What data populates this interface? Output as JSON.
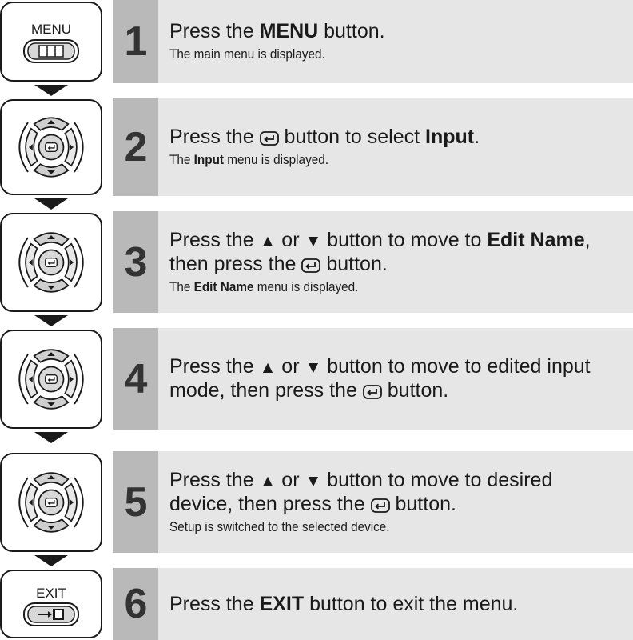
{
  "steps": [
    {
      "number": "1",
      "remote": "menu-button",
      "remote_label": "MENU",
      "main": {
        "a": "Press the ",
        "b": "MENU",
        "c": " button."
      },
      "sub": "The main menu is displayed."
    },
    {
      "number": "2",
      "remote": "directional-pad",
      "main": {
        "a": "Press the ",
        "b": " button to select ",
        "c": "Input",
        "d": "."
      },
      "sub": {
        "a": "Input",
        "b": " menu is displayed.",
        "prefix": "The "
      }
    },
    {
      "number": "3",
      "remote": "directional-pad",
      "main": {
        "a": "Press the ",
        "up": "▲",
        "or": " or ",
        "down": "▼",
        "b": " button to move to ",
        "c": "Edit Name",
        "d": ",",
        "e": "then press the ",
        "f": " button."
      },
      "sub": {
        "prefix": "The ",
        "a": "Edit Name",
        "b": " menu is displayed."
      }
    },
    {
      "number": "4",
      "remote": "directional-pad",
      "main": {
        "a": "Press the ",
        "up": "▲",
        "or": " or ",
        "down": "▼",
        "b": " button to move to edited input",
        "e": "mode, then press the ",
        "f": " button."
      }
    },
    {
      "number": "5",
      "remote": "directional-pad",
      "main": {
        "a": "Press the ",
        "up": "▲",
        "or": " or ",
        "down": "▼",
        "b": " button to move to desired",
        "e": "device, then press the ",
        "f": " button."
      },
      "sub": "Setup is switched to the selected device."
    },
    {
      "number": "6",
      "remote": "exit-button",
      "remote_label": "EXIT",
      "main": {
        "a": "Press the ",
        "b": "EXIT",
        "c": " button to exit the menu."
      }
    }
  ]
}
